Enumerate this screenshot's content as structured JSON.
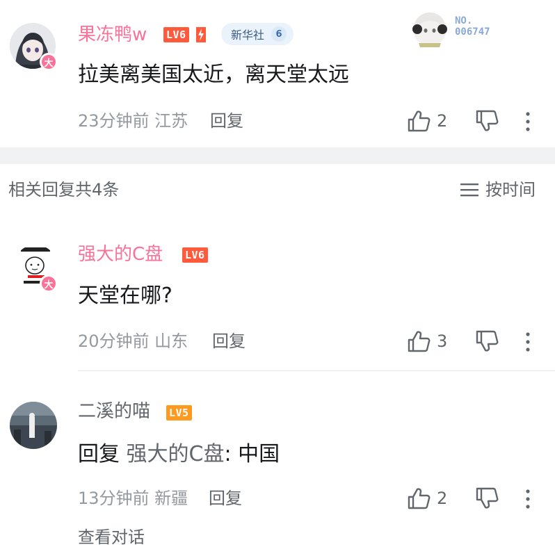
{
  "top_comment": {
    "username": "果冻鸭w",
    "level": "LV6",
    "avatar_badge": "大",
    "fan_badge": {
      "name": "新华社",
      "level": "6"
    },
    "card_no_label": "NO.",
    "card_no_value": "006747",
    "content": "拉美离美国太近，离天堂太远",
    "meta": "23分钟前 江苏",
    "reply_label": "回复",
    "likes": "2"
  },
  "replies_header": {
    "title": "相关回复共4条",
    "sort_label": "按时间"
  },
  "replies": [
    {
      "username": "强大的C盘",
      "level": "LV6",
      "avatar_badge": "大",
      "content": "天堂在哪?",
      "meta": "20分钟前 山东",
      "reply_label": "回复",
      "likes": "3"
    },
    {
      "username": "二溪的喵",
      "level": "LV5",
      "content_prefix": "回复 ",
      "content_ref": "强大的C盘",
      "content_rest": ": 中国",
      "meta": "13分钟前 新疆",
      "reply_label": "回复",
      "likes": "2",
      "view_conversation": "查看对话"
    }
  ],
  "colors": {
    "pink": "#fb7299",
    "lv6": "#ff5a3c",
    "lv5": "#ff9a1f",
    "gray_text": "#9499a0",
    "dark_text": "#18191c"
  },
  "icons": [
    "like-icon",
    "dislike-icon",
    "more-icon",
    "sort-icon"
  ]
}
